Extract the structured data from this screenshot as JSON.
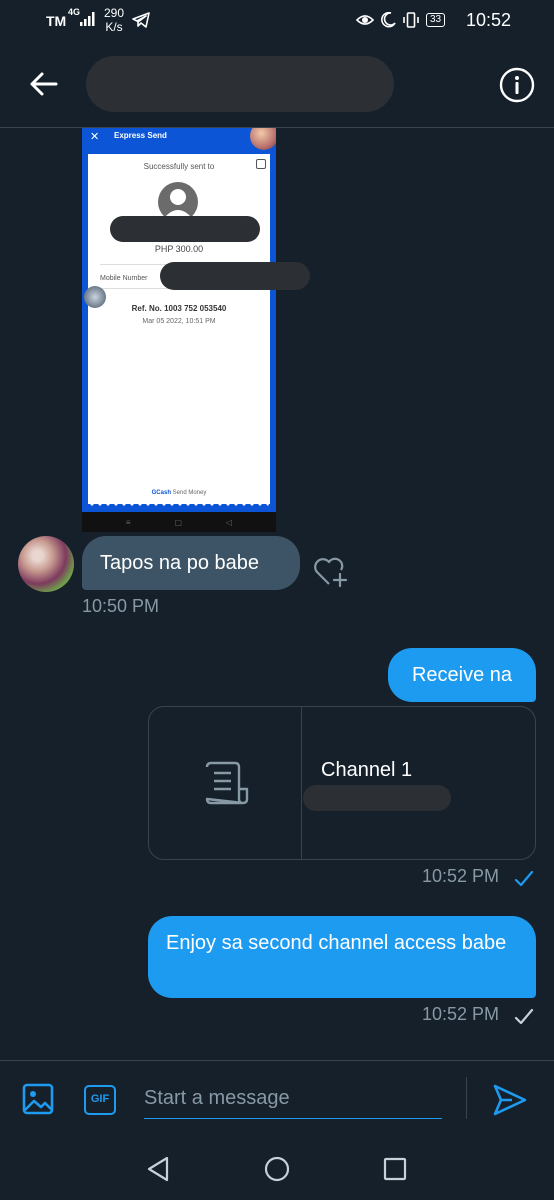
{
  "status_bar": {
    "carrier": "TM",
    "network": "4G",
    "speed_value": "290",
    "speed_unit": "K/s",
    "battery": "33",
    "time": "10:52"
  },
  "header": {
    "back_icon": "arrow-left-icon",
    "info_icon": "info-circle-icon"
  },
  "attachment": {
    "app_title": "Express Send",
    "sent_label": "Successfully sent to",
    "amount": "PHP 300.00",
    "mobile_label": "Mobile Number",
    "ref_no": "Ref. No. 1003 752 053540",
    "date": "Mar 05 2022, 10:51 PM",
    "footer_brand": "GCash",
    "footer_text": "Send Money"
  },
  "messages": [
    {
      "direction": "incoming",
      "text": "Tapos na po babe",
      "time": "10:50 PM"
    },
    {
      "direction": "outgoing",
      "text": "Receive na"
    },
    {
      "direction": "outgoing",
      "type": "link-card",
      "title": "Channel 1",
      "time": "10:52 PM",
      "status": "read"
    },
    {
      "direction": "outgoing",
      "text": "Enjoy sa second channel access babe",
      "time": "10:52 PM",
      "status": "sent"
    }
  ],
  "composer": {
    "placeholder": "Start a message",
    "gif_label": "GIF"
  },
  "colors": {
    "background": "#15202b",
    "accent": "#1d9bf0",
    "incoming_bubble": "#3d5466",
    "muted": "#8899a6"
  }
}
